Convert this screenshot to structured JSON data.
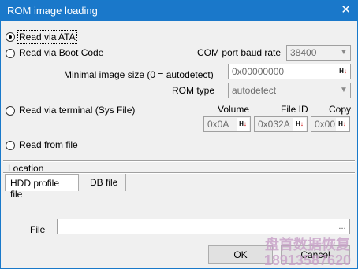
{
  "window": {
    "title": "ROM image loading",
    "close_glyph": "✕"
  },
  "source": {
    "ata_label": "Read via ATA",
    "boot_code_label": "Read via Boot Code",
    "terminal_label": "Read via terminal (Sys File)",
    "file_label": "Read from file",
    "selected": "ata"
  },
  "com_port": {
    "label": "COM port baud rate",
    "value": "38400"
  },
  "image_size": {
    "label": "Minimal image size (0 = autodetect)",
    "value": "0x00000000"
  },
  "rom_type": {
    "label": "ROM type",
    "value": "autodetect"
  },
  "terminal": {
    "volume_label": "Volume",
    "volume_value": "0x0A",
    "file_id_label": "File ID",
    "file_id_value": "0x032A",
    "copy_label": "Copy",
    "copy_value": "0x00"
  },
  "location": {
    "label": "Location",
    "tabs": [
      "HDD profile file",
      "DB file"
    ],
    "active_tab": "HDD profile file",
    "file_label": "File",
    "file_value": "",
    "browse_label": "..."
  },
  "buttons": {
    "ok": "OK",
    "cancel": "Cancel"
  },
  "watermark": {
    "line1": "盘首数据恢复",
    "line2": "18913587620"
  },
  "colors": {
    "titlebar": "#1a78ca",
    "arrow": "#cc0000"
  }
}
